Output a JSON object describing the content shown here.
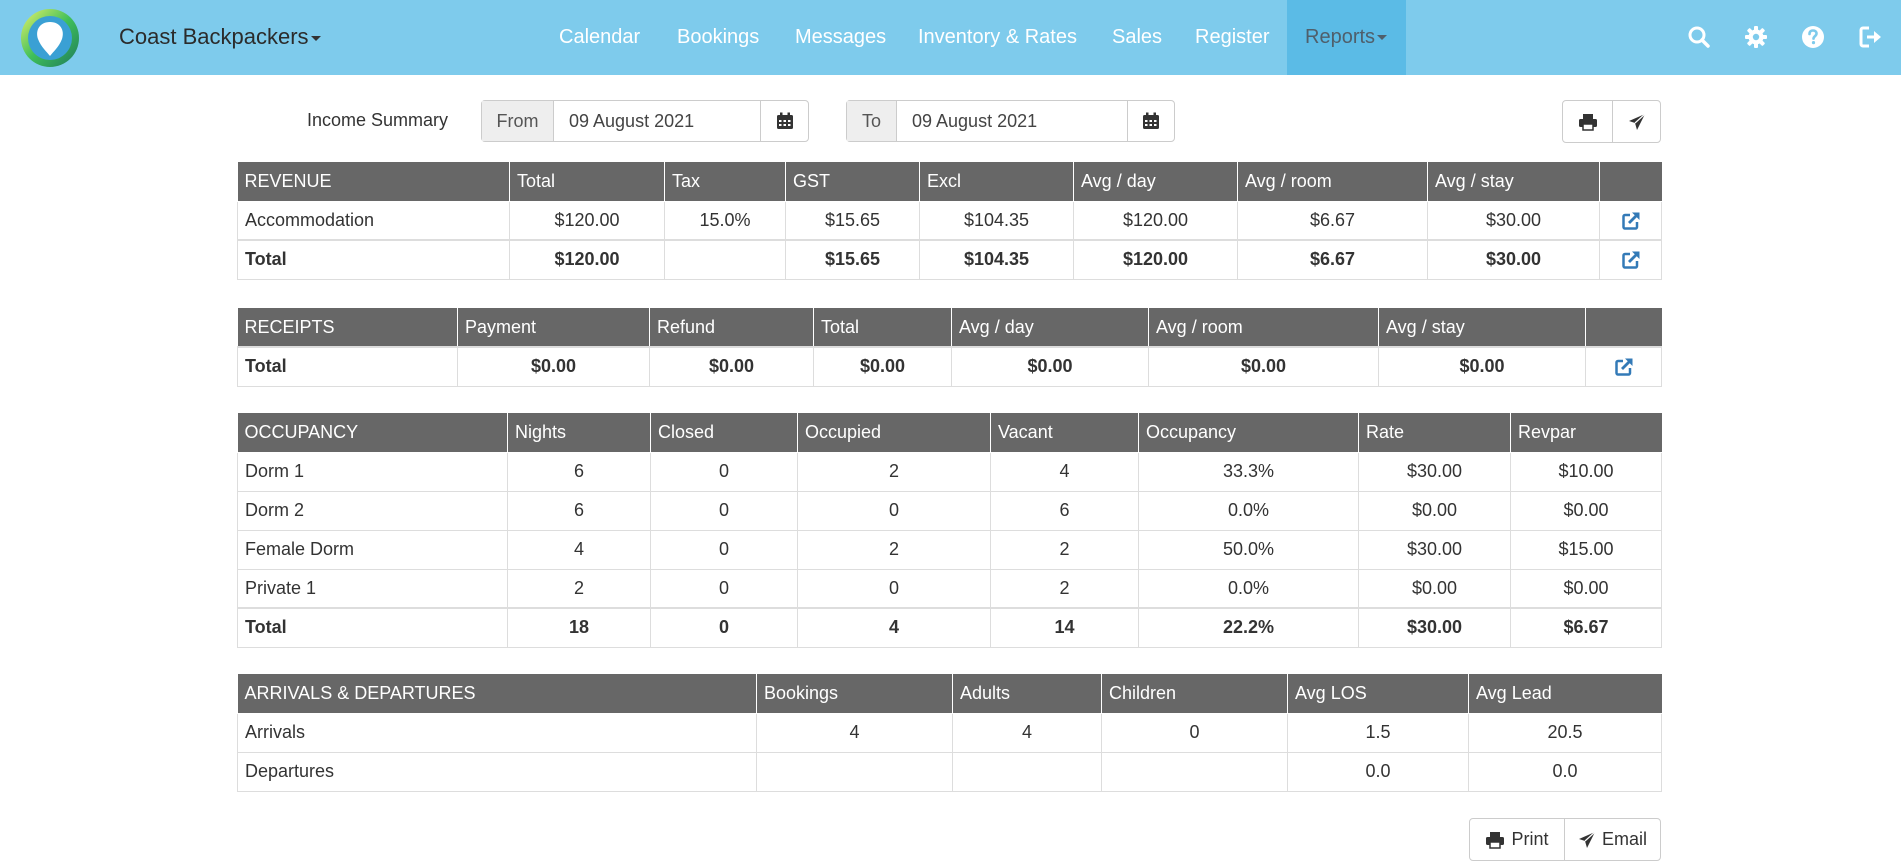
{
  "brand": {
    "name": "Coast Backpackers"
  },
  "nav": {
    "calendar": "Calendar",
    "bookings": "Bookings",
    "messages": "Messages",
    "inventory": "Inventory & Rates",
    "sales": "Sales",
    "register": "Register",
    "reports": "Reports"
  },
  "icons": [
    "search-icon",
    "settings-gear-icon",
    "help-icon",
    "logout-icon",
    "calendar-icon",
    "print-icon",
    "send-icon",
    "external-link-icon"
  ],
  "colors": {
    "navbar": "#7ecbec",
    "nav_active": "#5bbbe6",
    "table_header": "#676767",
    "link_icon": "#337ab7"
  },
  "toolbar": {
    "title": "Income Summary",
    "from_label": "From",
    "from_value": "09 August 2021",
    "to_label": "To",
    "to_value": "09 August 2021",
    "print_label": "Print",
    "email_label": "Email"
  },
  "revenue": {
    "headers": [
      "REVENUE",
      "Total",
      "Tax",
      "GST",
      "Excl",
      "Avg / day",
      "Avg / room",
      "Avg / stay"
    ],
    "rows": [
      [
        "Accommodation",
        "$120.00",
        "15.0%",
        "$15.65",
        "$104.35",
        "$120.00",
        "$6.67",
        "$30.00"
      ]
    ],
    "total": [
      "Total",
      "$120.00",
      "",
      "$15.65",
      "$104.35",
      "$120.00",
      "$6.67",
      "$30.00"
    ]
  },
  "receipts": {
    "headers": [
      "RECEIPTS",
      "Payment",
      "Refund",
      "Total",
      "Avg / day",
      "Avg / room",
      "Avg / stay"
    ],
    "total": [
      "Total",
      "$0.00",
      "$0.00",
      "$0.00",
      "$0.00",
      "$0.00",
      "$0.00"
    ]
  },
  "occupancy": {
    "headers": [
      "OCCUPANCY",
      "Nights",
      "Closed",
      "Occupied",
      "Vacant",
      "Occupancy",
      "Rate",
      "Revpar"
    ],
    "rows": [
      [
        "Dorm 1",
        "6",
        "0",
        "2",
        "4",
        "33.3%",
        "$30.00",
        "$10.00"
      ],
      [
        "Dorm 2",
        "6",
        "0",
        "0",
        "6",
        "0.0%",
        "$0.00",
        "$0.00"
      ],
      [
        "Female Dorm",
        "4",
        "0",
        "2",
        "2",
        "50.0%",
        "$30.00",
        "$15.00"
      ],
      [
        "Private 1",
        "2",
        "0",
        "0",
        "2",
        "0.0%",
        "$0.00",
        "$0.00"
      ]
    ],
    "total": [
      "Total",
      "18",
      "0",
      "4",
      "14",
      "22.2%",
      "$30.00",
      "$6.67"
    ]
  },
  "arrivals": {
    "headers": [
      "ARRIVALS & DEPARTURES",
      "Bookings",
      "Adults",
      "Children",
      "Avg LOS",
      "Avg Lead"
    ],
    "rows": [
      [
        "Arrivals",
        "4",
        "4",
        "0",
        "1.5",
        "20.5"
      ],
      [
        "Departures",
        "",
        "",
        "",
        "0.0",
        "0.0"
      ]
    ]
  }
}
